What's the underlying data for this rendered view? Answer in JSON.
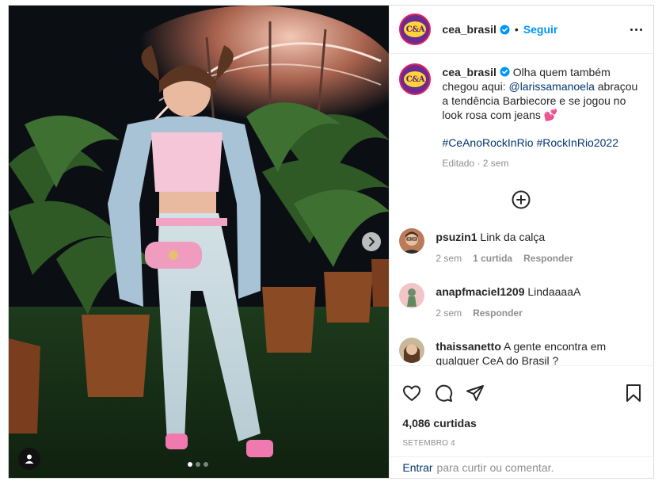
{
  "header": {
    "username": "cea_brasil",
    "separator": "•",
    "follow_label": "Seguir",
    "brand_mark": "C&A"
  },
  "caption": {
    "username": "cea_brasil",
    "text_before_mention": "Olha quem também chegou aqui:",
    "mention": "@larissamanoela",
    "text_after_mention": "abraçou a tendência Barbiecore e se jogou no look rosa com jeans",
    "emoji": "💕",
    "hashtag_1": "#CeAnoRockInRio",
    "hashtag_2": "#RockInRio2022",
    "meta": "Editado · 2 sem"
  },
  "comments": [
    {
      "user": "psuzin1",
      "text": "Link da calça",
      "time": "2 sem",
      "likes": "1 curtida",
      "reply": "Responder"
    },
    {
      "user": "anapfmaciel1209",
      "text": "LindaaaaA",
      "time": "2 sem",
      "reply": "Responder"
    },
    {
      "user": "thaissanetto",
      "text": "A gente encontra em qualquer CeA do Brasil ?"
    }
  ],
  "actions": {
    "likes": "4,086 curtidas",
    "date": "SETEMBRO 4"
  },
  "login": {
    "enter_label": "Entrar",
    "prompt": "para curtir ou comentar."
  },
  "carousel": {
    "slides": 3,
    "active": 1
  },
  "colors": {
    "link_blue": "#0095f6",
    "dark_link": "#00376b",
    "muted": "#8e8e8e",
    "brand_purple": "#6a2a8f",
    "brand_yellow": "#ffd43b"
  },
  "icons": [
    "verified-icon",
    "more-options-icon",
    "add-circle-icon",
    "heart-icon",
    "comment-icon",
    "share-icon",
    "bookmark-icon",
    "chevron-right-icon",
    "user-tag-icon"
  ]
}
